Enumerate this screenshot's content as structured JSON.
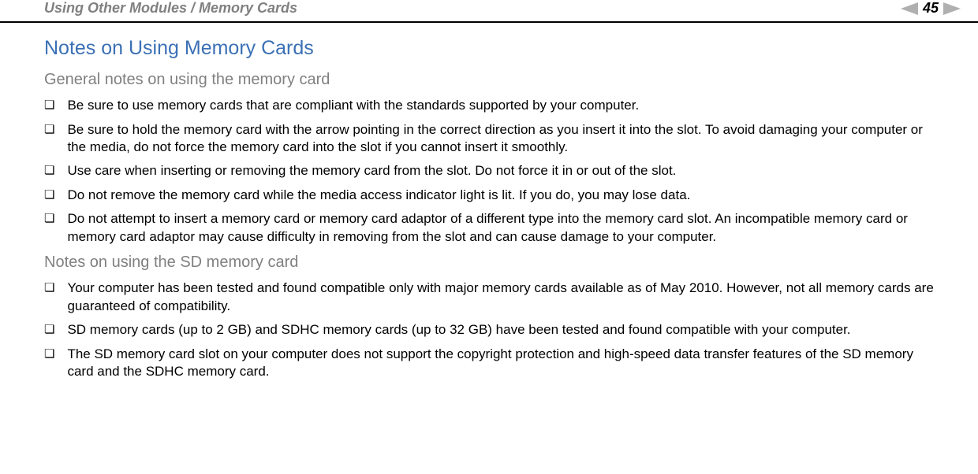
{
  "header": {
    "breadcrumb": "Using Other Modules / Memory Cards",
    "page_number": "45",
    "prev_label": "n",
    "next_label": "N"
  },
  "main": {
    "title": "Notes on Using Memory Cards",
    "section1": {
      "heading": "General notes on using the memory card",
      "items": [
        "Be sure to use memory cards that are compliant with the standards supported by your computer.",
        "Be sure to hold the memory card with the arrow pointing in the correct direction as you insert it into the slot. To avoid damaging your computer or the media, do not force the memory card into the slot if you cannot insert it smoothly.",
        "Use care when inserting or removing the memory card from the slot. Do not force it in or out of the slot.",
        "Do not remove the memory card while the media access indicator light is lit. If you do, you may lose data.",
        "Do not attempt to insert a memory card or memory card adaptor of a different type into the memory card slot. An incompatible memory card or memory card adaptor may cause difficulty in removing from the slot and can cause damage to your computer."
      ]
    },
    "section2": {
      "heading": "Notes on using the SD memory card",
      "items": [
        "Your computer has been tested and found compatible only with major memory cards available as of May 2010. However, not all memory cards are guaranteed of compatibility.",
        "SD memory cards (up to 2 GB) and SDHC memory cards (up to 32 GB) have been tested and found compatible with your computer.",
        "The SD memory card slot on your computer does not support the copyright protection and high-speed data transfer features of the SD memory card and the SDHC memory card."
      ]
    }
  }
}
